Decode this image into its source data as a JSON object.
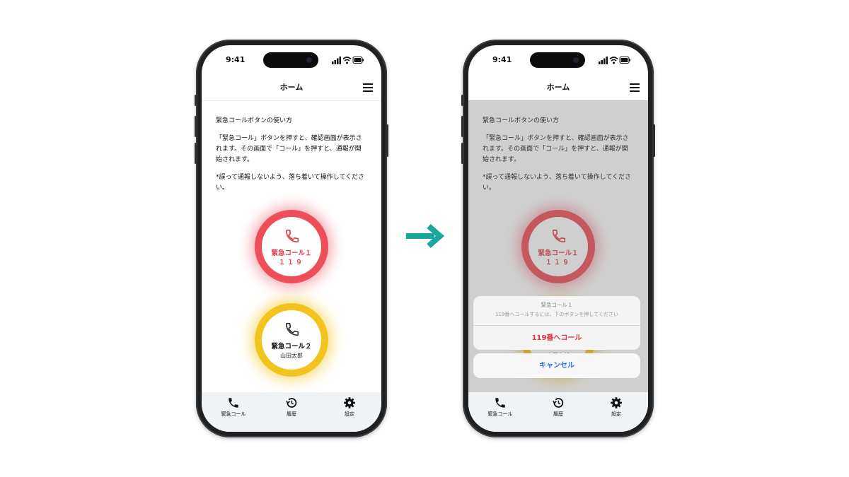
{
  "status_bar": {
    "time": "9:41"
  },
  "header": {
    "title": "ホーム"
  },
  "instructions": {
    "heading": "緊急コールボタンの使い方",
    "paragraph1": "「緊急コール」ボタンを押すと、確認画面が表示されます。その画面で「コール」を押すと、通報が開始されます。",
    "paragraph2": "*誤って通報しないよう、落ち着いて操作してください。"
  },
  "buttons": {
    "call1": {
      "label": "緊急コール１",
      "sub": "１１９",
      "color": "#ee4e59"
    },
    "call2": {
      "label": "緊急コール２",
      "sub": "山田太郎",
      "color": "#f3c41d"
    }
  },
  "tabs": [
    {
      "label": "緊急コール",
      "icon": "phone-icon"
    },
    {
      "label": "履歴",
      "icon": "history-icon"
    },
    {
      "label": "設定",
      "icon": "gear-icon"
    }
  ],
  "action_sheet": {
    "title": "緊急コール１",
    "message": "119番へコールするには、下のボタンを押してください",
    "action": "119番へコール",
    "cancel": "キャンセル"
  },
  "colors": {
    "accent_red": "#e8303c",
    "link_blue": "#2f6fd6",
    "arrow_teal": "#1aa89a",
    "tabbar_bg": "#f0f3f6"
  }
}
